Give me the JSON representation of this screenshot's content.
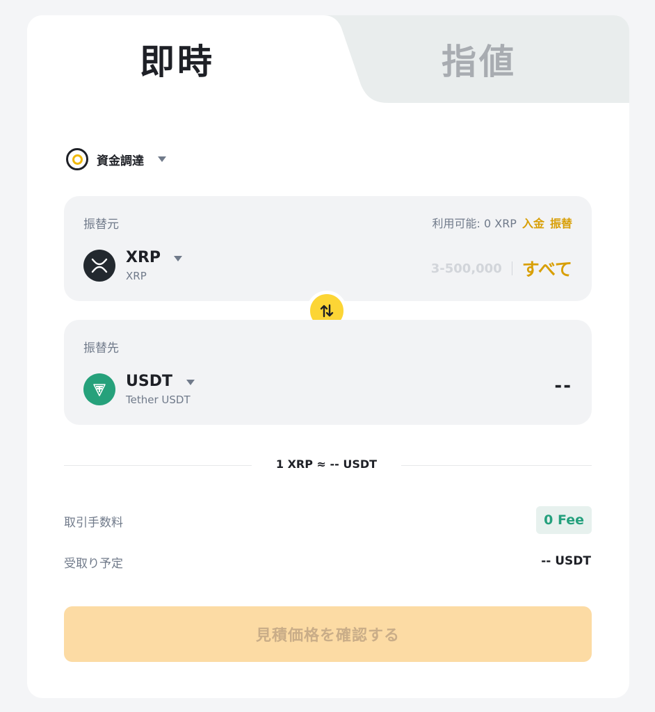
{
  "tabs": {
    "instant": "即時",
    "limit": "指値"
  },
  "funding": {
    "label": "資金調達",
    "icon": "funding-coin-icon"
  },
  "from": {
    "title": "振替元",
    "available": "利用可能: 0 XRP",
    "deposit_link": "入金",
    "transfer_link": "振替",
    "coin_symbol": "XRP",
    "coin_name": "XRP",
    "range_placeholder": "3-500,000",
    "max_label": "すべて"
  },
  "to": {
    "title": "振替先",
    "coin_symbol": "USDT",
    "coin_name": "Tether USDT",
    "amount": "--"
  },
  "rate": "1 XRP ≈ -- USDT",
  "fee": {
    "label": "取引手数料",
    "value": "0 Fee"
  },
  "receive": {
    "label": "受取り予定",
    "value": "-- USDT"
  },
  "confirm_button": "見積価格を確認する",
  "colors": {
    "accent": "#d89f06",
    "swap": "#fcd535",
    "usdt": "#26a17b",
    "fee": "#24a07d"
  }
}
